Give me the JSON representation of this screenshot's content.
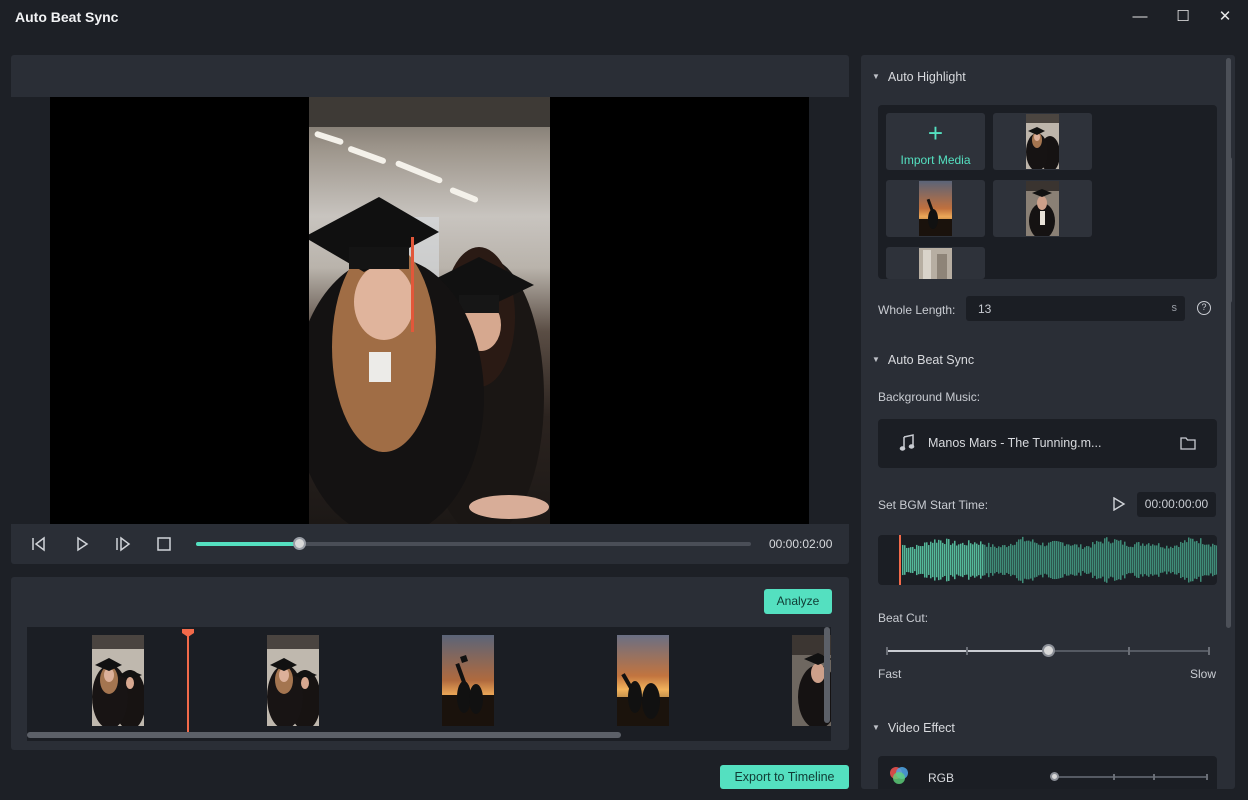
{
  "window": {
    "title": "Auto Beat Sync",
    "minimize": "—",
    "maximize": "☐",
    "close": "✕"
  },
  "player": {
    "time": "00:00:02:00",
    "progress_fraction": 0.185
  },
  "timeline": {
    "analyze_label": "Analyze",
    "clips": [
      "grad-clip-1",
      "grad-clip-2",
      "sunset-clip-1",
      "sunset-clip-2",
      "grad-clip-3"
    ]
  },
  "footer": {
    "export_label": "Export to Timeline"
  },
  "auto_highlight": {
    "heading": "Auto Highlight",
    "import_label": "Import Media",
    "import_plus": "+",
    "whole_length_label": "Whole Length:",
    "whole_length_value": "13",
    "whole_length_unit": "s",
    "help": "?"
  },
  "auto_beat_sync": {
    "heading": "Auto Beat Sync",
    "background_music_label": "Background Music:",
    "music_title": "Manos Mars - The Tunning.m...",
    "bgm_start_label": "Set BGM Start Time:",
    "bgm_start_time": "00:00:00:00",
    "beat_cut_label": "Beat Cut:",
    "beat_fast": "Fast",
    "beat_slow": "Slow",
    "beat_cut_fraction": 0.5
  },
  "video_effect": {
    "heading": "Video Effect",
    "effect_name": "RGB"
  },
  "colors": {
    "accent": "#54e0c0",
    "playhead": "#f26a4a",
    "panel": "#2a2e36",
    "background": "#1d2026"
  }
}
